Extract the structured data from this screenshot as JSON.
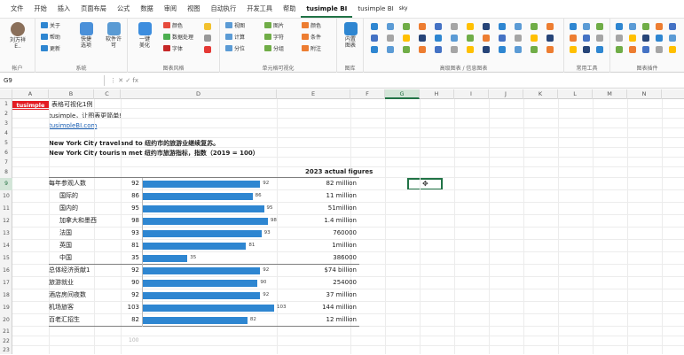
{
  "menus": [
    "文件",
    "开始",
    "插入",
    "页面布局",
    "公式",
    "数据",
    "审阅",
    "视图",
    "自动执行",
    "开发工具",
    "帮助",
    "tusimple BI",
    "tusimple BI"
  ],
  "menu_sup": "sky",
  "ribbon": {
    "account": {
      "name": "刘万祥",
      "sub": "E..",
      "label": "帐户"
    },
    "sys": {
      "items": [
        "关于",
        "帮助",
        "更新"
      ],
      "btn1": "快捷\n选项",
      "btn2": "软件许\n可",
      "label": "系统"
    },
    "fmt": {
      "btn": "一键\n美化",
      "items": [
        "颜色",
        "数据处理",
        "字体"
      ],
      "label": "图表风格"
    },
    "cells": {
      "items1": [
        "视图",
        "计算",
        "分位"
      ],
      "items2": [
        "图片",
        "字符",
        "分组"
      ],
      "items3": [
        "颜色",
        "条件",
        "附注"
      ],
      "label": "单元格可视化"
    },
    "filter": {
      "btn": "内置\n图表",
      "label": "图库"
    },
    "adv": {
      "label": "高级图表 / 信息图表"
    },
    "tools": {
      "label": "常用工具"
    },
    "assist": {
      "label": "图表插件"
    }
  },
  "namebox": "G9",
  "fx_icons": "⋮  ✕  ✓  fx",
  "columns": [
    "A",
    "B",
    "C",
    "D",
    "E",
    "F",
    "G",
    "H",
    "I",
    "J",
    "K",
    "L",
    "M",
    "N"
  ],
  "selected_col": "G",
  "rows": [
    "1",
    "2",
    "3",
    "4",
    "5",
    "6",
    "7",
    "8",
    "9",
    "10",
    "11",
    "12",
    "13",
    "14",
    "15",
    "16",
    "17",
    "18",
    "19",
    "20",
    "21",
    "22",
    "23"
  ],
  "selected_row": "9",
  "sheet": {
    "badge": "tusimple",
    "title": "表格可视化1例",
    "subtitle": "tusimple，让图表更简单!",
    "link": "tusimpleBI.com",
    "heading1": "New York City traveland to 纽约市的旅游业继续复苏。",
    "heading2": "New York City tourism met 纽约市旅游指标，指数（2019 = 100）",
    "actual_header": "2023 actual figures",
    "axis_label": "100",
    "items": [
      {
        "label": "每年参观人数",
        "value": 92,
        "actual": "82 million",
        "indent": false
      },
      {
        "label": "国际的",
        "value": 86,
        "actual": "11 million",
        "indent": true
      },
      {
        "label": "国内的",
        "value": 95,
        "actual": "51million",
        "indent": true
      },
      {
        "label": "加拿大和墨西",
        "value": 98,
        "actual": "1.4 million",
        "indent": true
      },
      {
        "label": "法国",
        "value": 93,
        "actual": "760000",
        "indent": true
      },
      {
        "label": "英国",
        "value": 81,
        "actual": "1million",
        "indent": true
      },
      {
        "label": "中国",
        "value": 35,
        "actual": "386000",
        "indent": true
      },
      {
        "label": "总体经济贡献1",
        "value": 92,
        "actual": "$74 billion",
        "indent": false
      },
      {
        "label": "旅游就业",
        "value": 90,
        "actual": "254000",
        "indent": false
      },
      {
        "label": "酒店房间夜数",
        "value": 92,
        "actual": "37 million",
        "indent": false
      },
      {
        "label": "机场旅客",
        "value": 103,
        "actual": "144 million",
        "indent": false
      },
      {
        "label": "百老汇招生",
        "value": 82,
        "actual": "12 million",
        "indent": false
      }
    ]
  },
  "colors": {
    "bar": "#2e86d1",
    "badge": "#e31c23",
    "accent": "#217346"
  }
}
